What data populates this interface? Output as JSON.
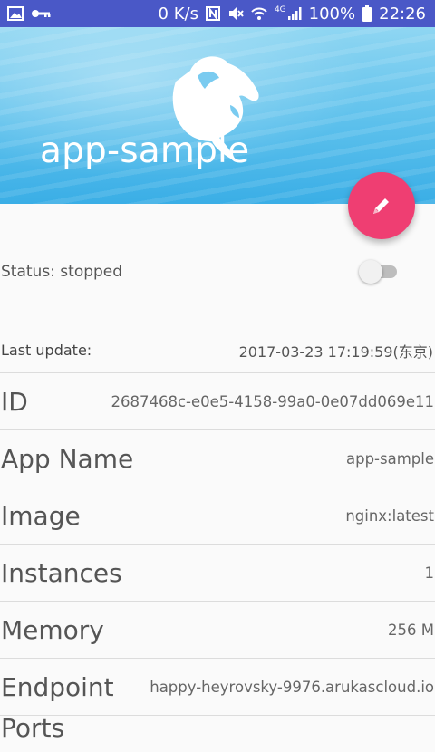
{
  "status_bar": {
    "network_speed": "0 K/s",
    "network_type": "4G",
    "battery": "100%",
    "time": "22:26"
  },
  "header": {
    "app_name": "app-sample"
  },
  "status": {
    "label": "Status: stopped",
    "running": false
  },
  "last_update": {
    "label": "Last update:",
    "value": "2017-03-23 17:19:59(东京)"
  },
  "details": [
    {
      "label": "ID",
      "value": "2687468c-e0e5-4158-99a0-0e07dd069e11"
    },
    {
      "label": "App Name",
      "value": "app-sample"
    },
    {
      "label": "Image",
      "value": "nginx:latest"
    },
    {
      "label": "Instances",
      "value": "1"
    },
    {
      "label": "Memory",
      "value": "256 M"
    },
    {
      "label": "Endpoint",
      "value": "happy-heyrovsky-9976.arukascloud.io"
    }
  ],
  "partial_row_label": "Ports",
  "colors": {
    "status_bar": "#4a58c7",
    "fab": "#ef3e72",
    "hero_top": "#8fd6f2",
    "hero_bottom": "#3aaee6"
  }
}
